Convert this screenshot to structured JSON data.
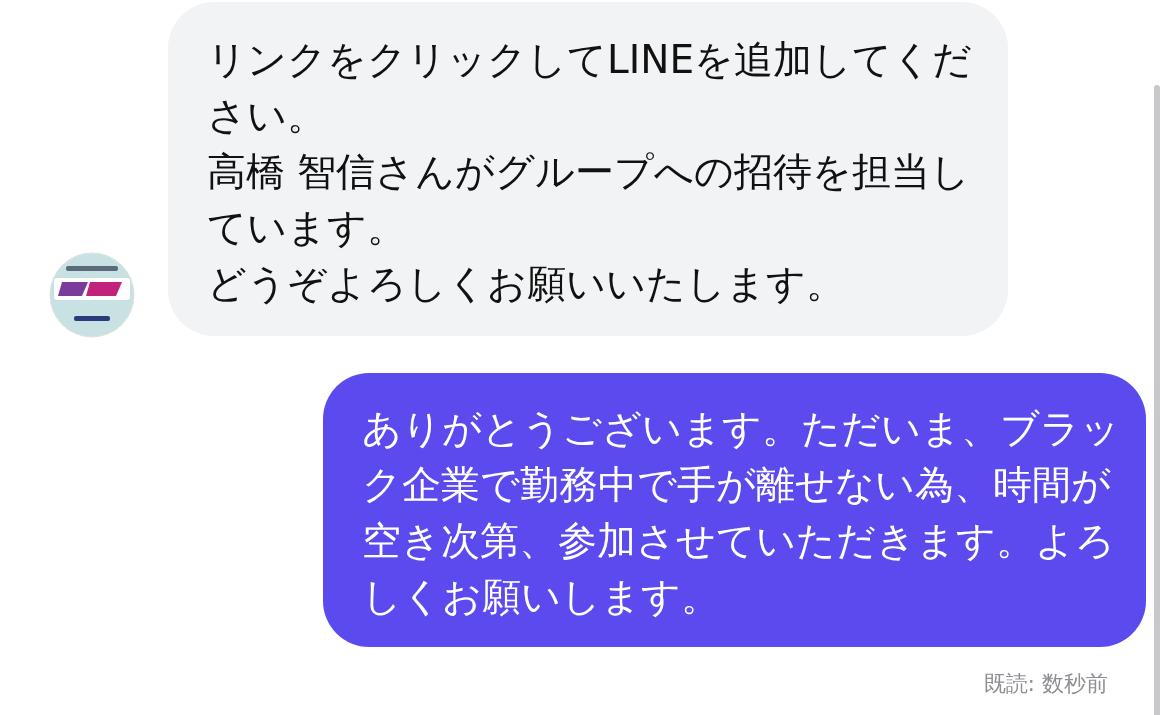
{
  "messages": [
    {
      "kind": "incoming",
      "paragraphs": [
        "リンクをクリックしてLINEを追加してください。",
        "高橋 智信さんがグループへの招待を担当しています。",
        "どうぞよろしくお願いいたします。"
      ]
    },
    {
      "kind": "outgoing",
      "paragraphs": [
        "ありがとうございます。ただいま、ブラック企業で勤務中で手が離せない為、時間が空き次第、参加させていただきます。よろしくお願いします。"
      ]
    }
  ],
  "read_receipt": "既読: 数秒前"
}
